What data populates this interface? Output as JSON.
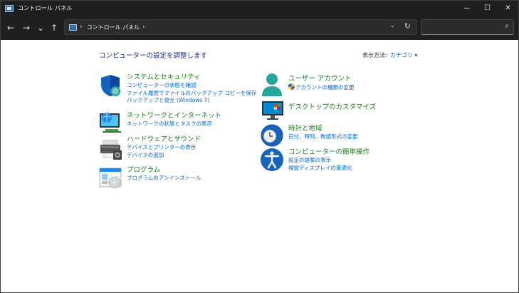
{
  "window": {
    "title": "コントロール パネル",
    "controls": {
      "minimize": "—",
      "maximize": "☐",
      "close": "✕"
    }
  },
  "nav": {
    "back": "←",
    "forward": "→",
    "recent": "⌄",
    "up": "↑",
    "address_sep": "›",
    "address_text": "コントロール パネル",
    "address_sep2": "›",
    "dropdown": "⌄",
    "refresh": "↻",
    "search_placeholder": "",
    "search_icon": "⌕"
  },
  "main": {
    "heading": "コンピューターの設定を調整します",
    "view_by_label": "表示方法:",
    "view_by_value": "カテゴリ ▾"
  },
  "categories_left": [
    {
      "title": "システムとセキュリティ",
      "links": [
        "コンピューターの状態を確認",
        "ファイル履歴でファイルのバックアップ コピーを保存",
        "バックアップと復元 (Windows 7)"
      ]
    },
    {
      "title": "ネットワークとインターネット",
      "links": [
        "ネットワークの状態とタスクの表示"
      ]
    },
    {
      "title": "ハードウェアとサウンド",
      "links": [
        "デバイスとプリンターの表示",
        "デバイスの追加"
      ]
    },
    {
      "title": "プログラム",
      "links": [
        "プログラムのアンインストール"
      ]
    }
  ],
  "categories_right": [
    {
      "title": "ユーザー アカウント",
      "links": [
        "アカウントの種類の変更"
      ]
    },
    {
      "title": "デスクトップのカスタマイズ",
      "links": []
    },
    {
      "title": "時計と地域",
      "links": [
        "日付、時刻、数値形式の変更"
      ]
    },
    {
      "title": "コンピューターの簡単操作",
      "links": [
        "設定の提案の表示",
        "視覚ディスプレイの最適化"
      ]
    }
  ]
}
